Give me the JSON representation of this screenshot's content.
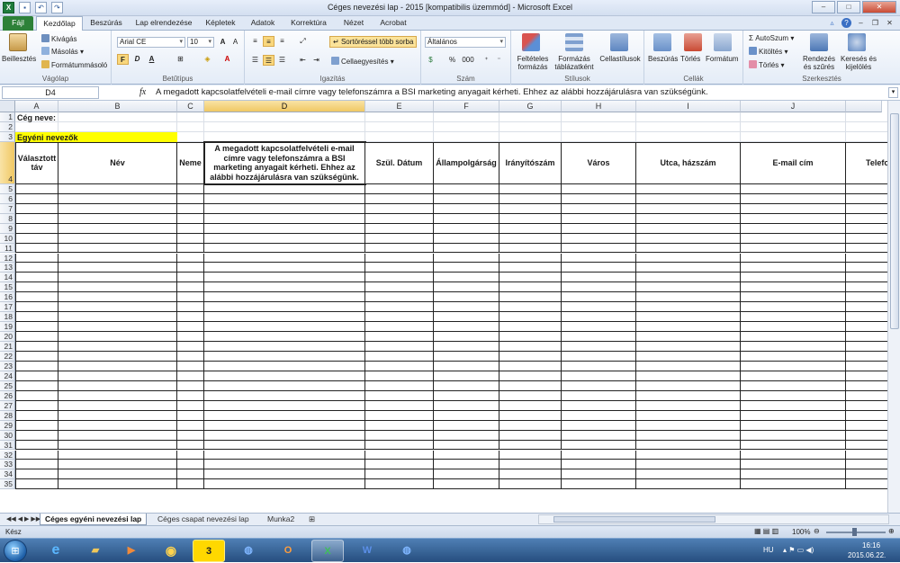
{
  "window": {
    "title": "Céges nevezési lap - 2015  [kompatibilis üzemmód]  -  Microsoft Excel",
    "controls": [
      "–",
      "□",
      "✕"
    ]
  },
  "tabs": {
    "file": "Fájl",
    "items": [
      "Kezdőlap",
      "Beszúrás",
      "Lap elrendezése",
      "Képletek",
      "Adatok",
      "Korrektúra",
      "Nézet",
      "Acrobat"
    ]
  },
  "ribbon": {
    "clipboard": {
      "paste": "Beillesztés",
      "cut": "Kivágás",
      "copy": "Másolás",
      "format_painter": "Formátummásoló",
      "label": "Vágólap"
    },
    "font": {
      "name": "Arial CE",
      "size": "10",
      "bold": "F",
      "italic": "D",
      "underline": "A",
      "label": "Betűtípus"
    },
    "alignment": {
      "wrap": "Sortöréssel több sorba",
      "merge": "Cellaegyesítés",
      "label": "Igazítás"
    },
    "number": {
      "format": "Általános",
      "percent": "%",
      "thousands": "000",
      "label": "Szám"
    },
    "styles": {
      "conditional": "Feltételes formázás",
      "table": "Formázás táblázatként",
      "cell_styles": "Cellastílusok",
      "label": "Stílusok"
    },
    "cells": {
      "insert": "Beszúrás",
      "delete": "Törlés",
      "format": "Formátum",
      "label": "Cellák"
    },
    "editing": {
      "autosum": "AutoSzum",
      "fill": "Kitöltés",
      "clear": "Törlés",
      "sort": "Rendezés és szűrés",
      "find": "Keresés és kijelölés",
      "label": "Szerkesztés"
    }
  },
  "formula_bar": {
    "name_box": "D4",
    "fx": "fx",
    "content": "A megadott kapcsolatfelvételi e-mail címre vagy telefonszámra a BSI marketing anyagait kérheti. Ehhez az alábbi hozzájárulásra van szükségünk."
  },
  "columns": [
    "A",
    "B",
    "C",
    "D",
    "E",
    "F",
    "G",
    "H",
    "I",
    "J"
  ],
  "rows": [
    "1",
    "2",
    "3",
    "4",
    "5",
    "6",
    "7",
    "8",
    "9",
    "10",
    "11",
    "12",
    "13",
    "14",
    "15",
    "16",
    "17",
    "18",
    "19",
    "20",
    "21",
    "22",
    "23",
    "24",
    "25",
    "26",
    "27",
    "28",
    "29",
    "30",
    "31",
    "32",
    "33",
    "34",
    "35"
  ],
  "sheet": {
    "company_label": "Cég neve:",
    "section_label": "Egyéni nevezők",
    "headers": {
      "a": "Választott táv",
      "b": "Név",
      "c": "Neme",
      "d": "A megadott kapcsolatfelvételi e-mail címre vagy telefonszámra a BSI marketing anyagait kérheti. Ehhez az alábbi hozzájárulásra van szükségünk.",
      "e": "Szül. Dátum",
      "f": "Állampolgárság",
      "g": "Irányítószám",
      "h": "Város",
      "i": "Utca, házszám",
      "j": "E-mail cím",
      "k": "Telefon"
    }
  },
  "sheet_tabs": [
    "Céges egyéni nevezési lap",
    "Céges csapat nevezési lap",
    "Munka2"
  ],
  "status": {
    "ready": "Kész",
    "zoom": "100%"
  },
  "taskbar": {
    "lang": "HU",
    "time": "16:16",
    "date": "2015.06.22."
  },
  "colors": {
    "accent": "#2d8138",
    "highlight": "#ffff00",
    "selection": "#f0c863"
  }
}
